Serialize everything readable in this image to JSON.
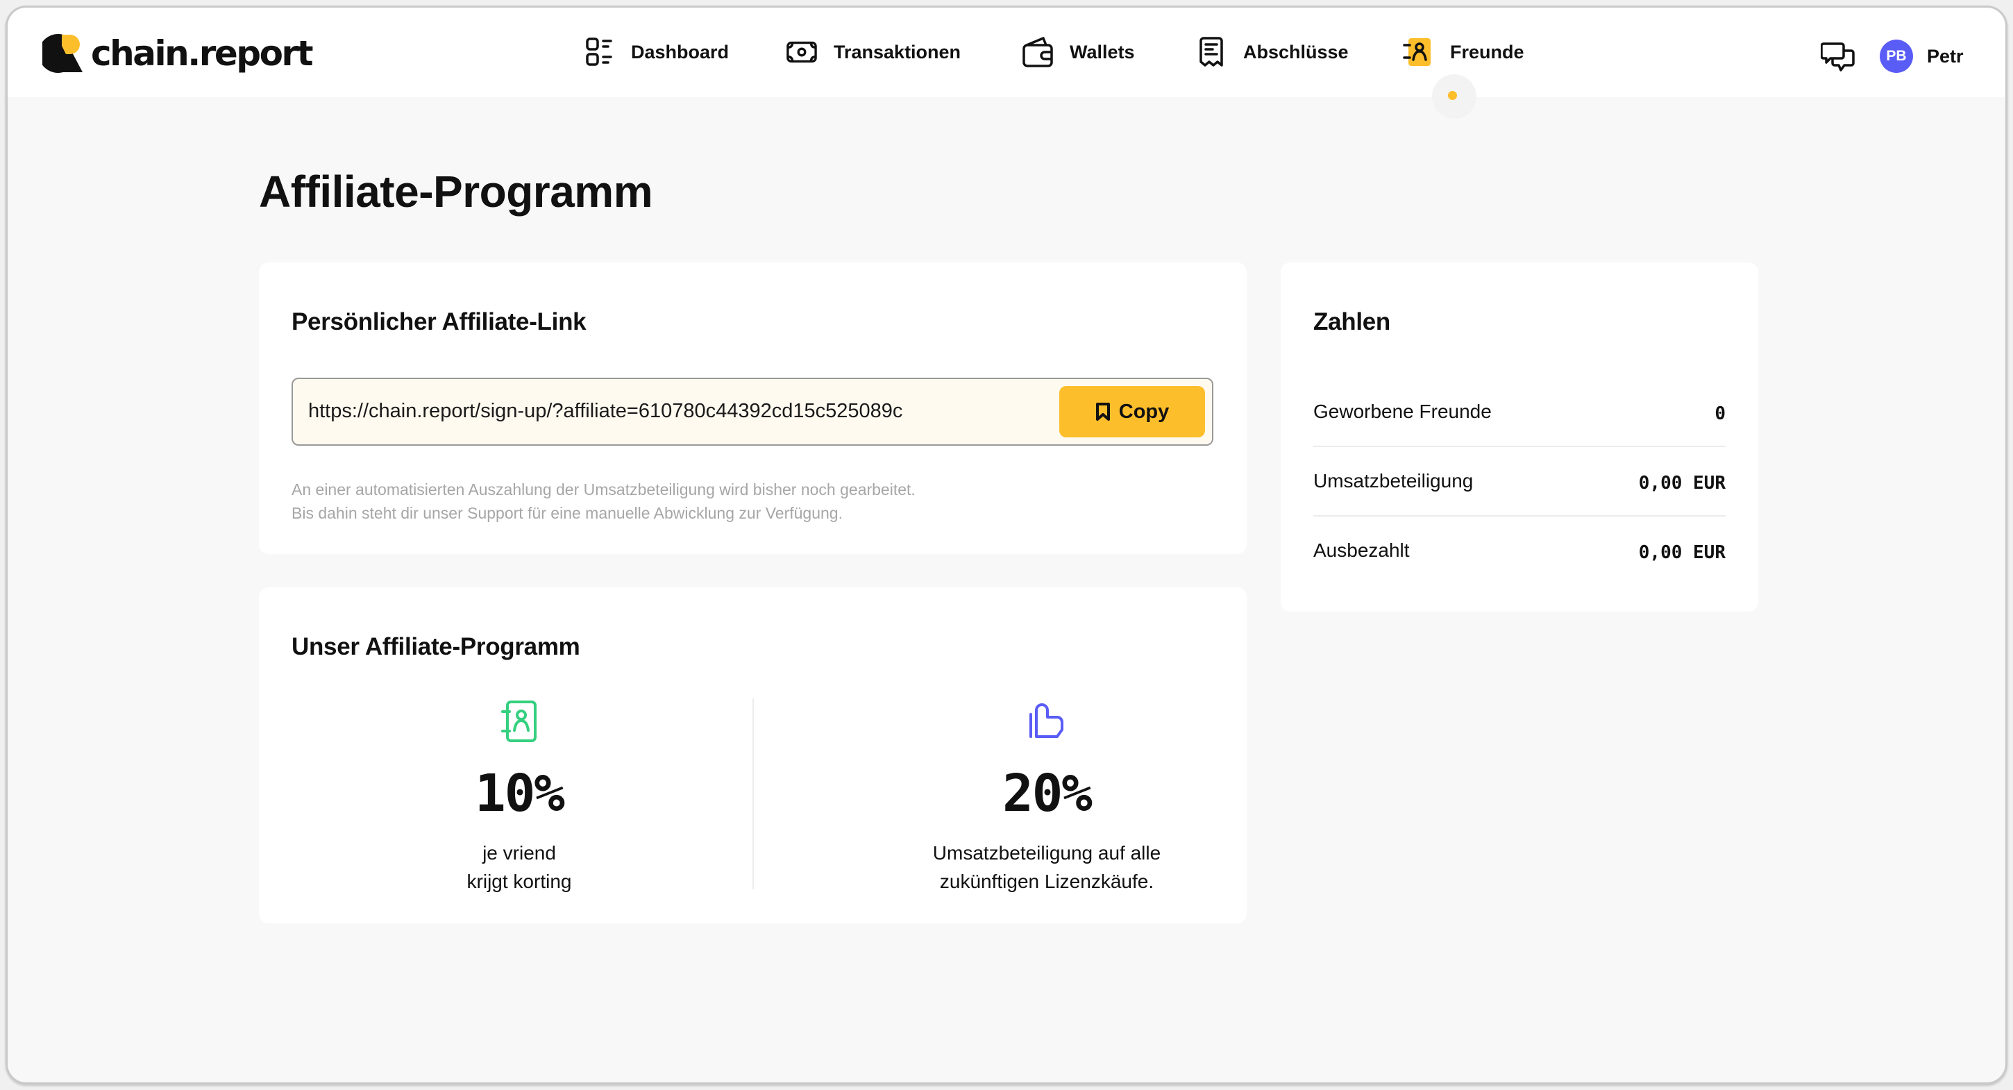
{
  "app": {
    "brand": "chain.report",
    "colors": {
      "accent": "#fdbe2c",
      "avatar": "#5a5cf6",
      "feature_green": "#35d07f",
      "feature_purple": "#5a5cf6"
    }
  },
  "nav": {
    "items": [
      {
        "label": "Dashboard",
        "icon": "dashboard-icon"
      },
      {
        "label": "Transaktionen",
        "icon": "banknote-icon"
      },
      {
        "label": "Wallets",
        "icon": "wallet-icon"
      },
      {
        "label": "Abschlüsse",
        "icon": "receipt-icon"
      },
      {
        "label": "Freunde",
        "icon": "contacts-icon",
        "active": true
      }
    ]
  },
  "header": {
    "chat_icon": "chat-bubbles-icon",
    "user": {
      "initials": "PB",
      "name": "Petr"
    }
  },
  "page": {
    "title": "Affiliate-Programm"
  },
  "link_card": {
    "title": "Persönlicher Affiliate-Link",
    "url": "https://chain.report/sign-up/?affiliate=610780c44392cd15c525089c",
    "copy_label": "Copy",
    "copy_icon": "bookmark-icon",
    "note_line1": "An einer automatisierten Auszahlung der Umsatzbeteiligung wird bisher noch gearbeitet.",
    "note_line2": "Bis dahin steht dir unser Support für eine manuelle Abwicklung zur Verfügung."
  },
  "program_card": {
    "title": "Unser Affiliate-Programm",
    "features": [
      {
        "icon": "contact-book-icon",
        "value": "10%",
        "line1": "je vriend",
        "line2": "krijgt korting"
      },
      {
        "icon": "thumbs-up-icon",
        "value": "20%",
        "line1": "Umsatzbeteiligung auf alle",
        "line2": "zukünftigen Lizenzkäufe."
      }
    ]
  },
  "stats_card": {
    "title": "Zahlen",
    "rows": [
      {
        "label": "Geworbene Freunde",
        "value": "0"
      },
      {
        "label": "Umsatzbeteiligung",
        "value": "0,00 EUR"
      },
      {
        "label": "Ausbezahlt",
        "value": "0,00 EUR"
      }
    ]
  }
}
